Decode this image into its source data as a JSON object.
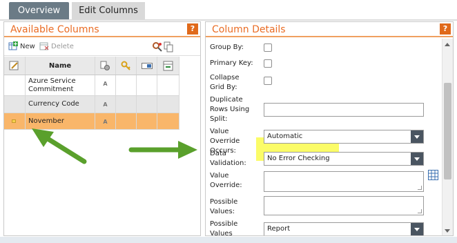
{
  "tabs": [
    {
      "label": "Overview"
    },
    {
      "label": "Edit Columns"
    }
  ],
  "left_panel": {
    "title": "Available Columns",
    "help": "?",
    "toolbar": {
      "new_label": "New",
      "delete_label": "Delete"
    },
    "grid": {
      "header_name": "Name",
      "rows": [
        {
          "name": "Azure Service Commitment",
          "type": "A"
        },
        {
          "name": "Currency Code",
          "type": "A"
        },
        {
          "name": "November",
          "type": "A",
          "selected": true
        }
      ]
    }
  },
  "right_panel": {
    "title": "Column Details",
    "help": "?",
    "fields": {
      "group_by": "Group By:",
      "primary_key": "Primary Key:",
      "collapse_grid": "Collapse Grid By:",
      "duplicate_rows": "Duplicate Rows Using Split:",
      "value_override_occurs": "Value Override Occurs:",
      "value_override_occurs_value": "Automatic",
      "data_validation": "Data Validation:",
      "data_validation_value": "No Error Checking",
      "value_override": "Value Override:",
      "possible_values": "Possible Values:",
      "possible_values_context": "Possible Values Context:",
      "possible_values_context_value": "Report"
    }
  },
  "colors": {
    "accent_orange": "#ea6c24",
    "selected_row": "#f9b66a",
    "arrow_green": "#5aa02c",
    "highlight_yellow": "#fbfc68"
  }
}
